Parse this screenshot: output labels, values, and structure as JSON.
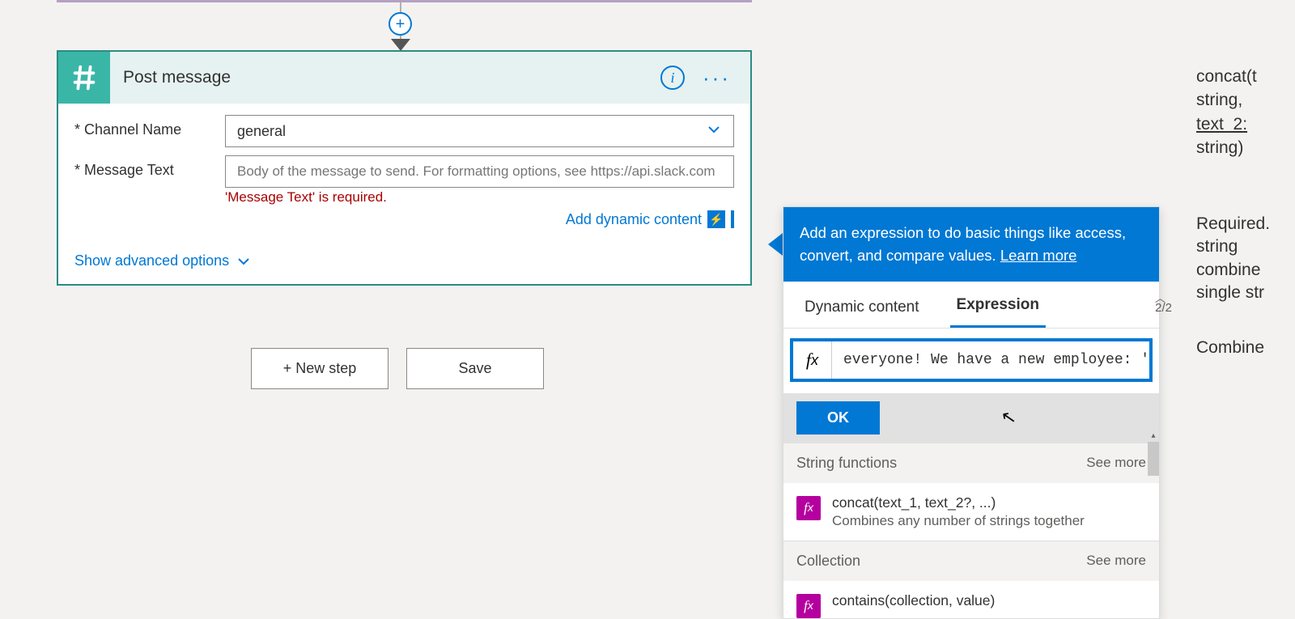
{
  "action": {
    "title": "Post message",
    "fields": {
      "channel": {
        "label": "Channel Name",
        "value": "general"
      },
      "message": {
        "label": "Message Text",
        "placeholder": "Body of the message to send. For formatting options, see https://api.slack.com",
        "error": "'Message Text' is required."
      }
    },
    "dynamic_link": "Add dynamic content",
    "advanced_link": "Show advanced options"
  },
  "buttons": {
    "new_step": "+ New step",
    "save": "Save"
  },
  "expr": {
    "banner": "Add an expression to do basic things like access, convert, and compare values.",
    "learn_more": "Learn more",
    "tabs": {
      "dynamic": "Dynamic content",
      "expression": "Expression"
    },
    "nav_count": "2/2",
    "fx_value": "everyone! We have a new employee: ', )",
    "ok": "OK",
    "sections": [
      {
        "name": "String functions",
        "see_more": "See more",
        "items": [
          {
            "title": "concat(text_1, text_2?, ...)",
            "desc": "Combines any number of strings together"
          }
        ]
      },
      {
        "name": "Collection",
        "see_more": "See more",
        "items": [
          {
            "title": "contains(collection, value)"
          }
        ]
      }
    ]
  },
  "help": {
    "line1": "concat(t",
    "line2": "string,",
    "line3": "text_2:",
    "line4": "string)",
    "mid1": "Combine",
    "req1": "Required.",
    "req2": "string",
    "req3": "combine",
    "req4": "single str"
  }
}
